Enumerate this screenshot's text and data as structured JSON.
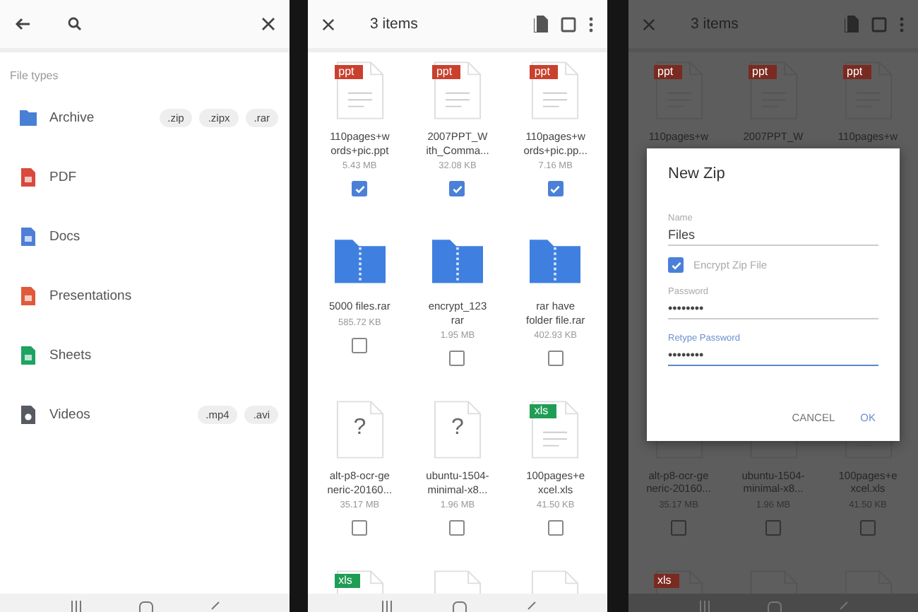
{
  "search_screen": {
    "section_label": "File types",
    "file_types": [
      {
        "name": "Archive",
        "kind": "archive",
        "extensions": [
          ".zip",
          ".zipx",
          ".rar"
        ]
      },
      {
        "name": "PDF",
        "kind": "pdf"
      },
      {
        "name": "Docs",
        "kind": "docs"
      },
      {
        "name": "Presentations",
        "kind": "presentations"
      },
      {
        "name": "Sheets",
        "kind": "sheets"
      },
      {
        "name": "Videos",
        "kind": "videos",
        "extensions": [
          ".mp4",
          ".avi"
        ]
      }
    ]
  },
  "selection_screen": {
    "title": "3 items",
    "files": [
      {
        "kind": "ppt",
        "badge": "ppt",
        "name_lines": [
          "110pages+w",
          "ords+pic.ppt"
        ],
        "size": "5.43 MB",
        "checked": true
      },
      {
        "kind": "ppt",
        "badge": "ppt",
        "name_lines": [
          "2007PPT_W",
          "ith_Comma..."
        ],
        "size": "32.08 KB",
        "checked": true
      },
      {
        "kind": "ppt",
        "badge": "ppt",
        "name_lines": [
          "110pages+w",
          "ords+pic.pp..."
        ],
        "size": "7.16 MB",
        "checked": true
      },
      {
        "kind": "zip",
        "name_lines": [
          "5000 files.rar"
        ],
        "size": "585.72 KB",
        "checked": false
      },
      {
        "kind": "zip",
        "name_lines": [
          "encrypt_123",
          "rar"
        ],
        "size": "1.95 MB",
        "checked": false
      },
      {
        "kind": "zip",
        "name_lines": [
          "rar have",
          "folder file.rar"
        ],
        "size": "402.93 KB",
        "checked": false
      },
      {
        "kind": "unknown",
        "badge": "?",
        "name_lines": [
          "alt-p8-ocr-ge",
          "neric-20160..."
        ],
        "size": "35.17 MB",
        "checked": false
      },
      {
        "kind": "unknown",
        "badge": "?",
        "name_lines": [
          "ubuntu-1504-",
          "minimal-x8..."
        ],
        "size": "1.96 MB",
        "checked": false
      },
      {
        "kind": "xls",
        "badge": "xls",
        "name_lines": [
          "100pages+e",
          "xcel.xls"
        ],
        "size": "41.50 KB",
        "checked": false
      },
      {
        "kind": "xls",
        "badge": "xls"
      },
      {
        "kind": "unknown"
      },
      {
        "kind": "unknown"
      }
    ]
  },
  "dialog_screen": {
    "title": "3 items",
    "top_files": [
      {
        "kind": "ppt",
        "badge": "ppt",
        "name_lines": [
          "110pages+w"
        ]
      },
      {
        "kind": "ppt",
        "badge": "ppt",
        "name_lines": [
          "2007PPT_W"
        ]
      },
      {
        "kind": "ppt",
        "badge": "ppt",
        "name_lines": [
          "110pages+w"
        ]
      }
    ],
    "bottom_files": [
      {
        "kind": "unknown",
        "name_lines": [
          "alt-p8-ocr-ge",
          "neric-20160..."
        ],
        "size": "35.17 MB",
        "checked": false
      },
      {
        "kind": "unknown",
        "name_lines": [
          "ubuntu-1504-",
          "minimal-x8..."
        ],
        "size": "1.96 MB",
        "checked": false
      },
      {
        "kind": "xls",
        "name_lines": [
          "100pages+e",
          "xcel.xls"
        ],
        "size": "41.50 KB",
        "checked": false
      },
      {
        "kind": "xls",
        "badge": "xls"
      },
      {
        "kind": "unknown"
      },
      {
        "kind": "unknown"
      }
    ],
    "dialog": {
      "title": "New Zip",
      "items": [
        {
          "kind": "field",
          "label": "Name",
          "value": "Files",
          "focused": false
        },
        {
          "kind": "checkbox",
          "label": "Encrypt Zip File",
          "checked": true
        },
        {
          "kind": "field",
          "label": "Password",
          "value": "••••••••",
          "focused": false
        },
        {
          "kind": "field",
          "label": "Retype Password",
          "value": "••••••••",
          "focused": true
        }
      ],
      "buttons": [
        "CANCEL",
        "OK"
      ]
    }
  }
}
